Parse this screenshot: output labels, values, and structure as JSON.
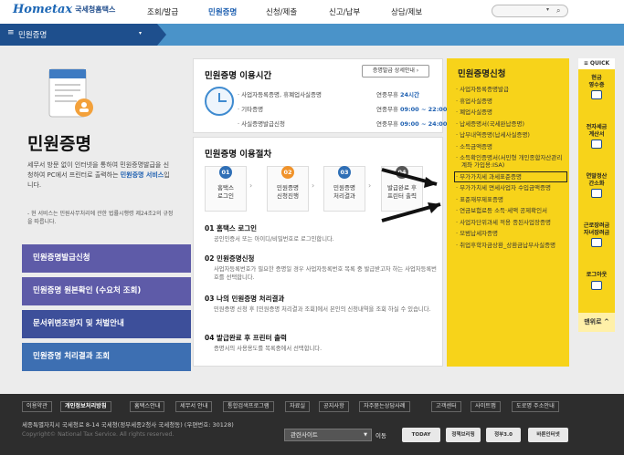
{
  "header": {
    "logo": "Hometax",
    "logo_sub": "국세청홈택스",
    "gnb": [
      "조회/발급",
      "민원증명",
      "신청/제출",
      "신고/납부",
      "상담/제보"
    ],
    "search_icon": "search-icon"
  },
  "nav": {
    "menu_icon": "≡",
    "title": "민원증명",
    "dropdown": "▾"
  },
  "left": {
    "title": "민원증명",
    "desc_a": "세무서 방문 없이 인터넷을 통하여 민원증명발급을 신청하여 PC에서 프린터로 출력하는 ",
    "desc_b": "민원증명 서비스",
    "desc_c": "입니다.",
    "note": "- 현 서비스는 민원사무처리에 관한 법률시행령 제24조2의 규정을 따릅니다.",
    "buttons": [
      "민원증명발급신청",
      "민원증명 원본확인 (수요처 조회)",
      "문서위변조방지 및 처벌안내",
      "민원증명 처리결과 조회"
    ],
    "button_colors": [
      "#5e5ba8",
      "#5e5ba8",
      "#3d4f9a",
      "#3d6fb2"
    ]
  },
  "hours": {
    "title": "민원증명 이용시간",
    "detail_button": "증명발급 상세안내 ›",
    "rows": [
      {
        "name": "· 사업자등록증명, 휴폐업사실증명",
        "val": "연중무휴 ",
        "val_b": "24시간"
      },
      {
        "name": "· 기타증명",
        "val": "연중무휴 ",
        "val_b": "09:00 ~ 22:00"
      },
      {
        "name": "· 사실증명발급신청",
        "val": "연중무휴 ",
        "val_b": "09:00 ~ 24:00"
      }
    ]
  },
  "procedure": {
    "title": "민원증명 이용절차",
    "steps": [
      {
        "num": "01",
        "label": "홈택스\n로그인",
        "color": "#2f6fb6"
      },
      {
        "num": "02",
        "label": "민원증명\n신청진행",
        "color": "#f0932b"
      },
      {
        "num": "03",
        "label": "민원증명\n처리결과",
        "color": "#2f6fb6"
      },
      {
        "num": "04",
        "label": "발급완료 후\n프린터 출력",
        "color": "#555"
      }
    ],
    "items": [
      {
        "h": "01 홈택스 로그인",
        "t": "공인인증서 또는 아이디/비밀번호로 로그인합니다."
      },
      {
        "h": "02 민원증명신청",
        "t": "사업자등록번호가 필요한 증명일 경우 사업자등록번호 목록 중 발급받고자 하는 사업자등록번호를 선택합니다."
      },
      {
        "h": "03 나의 민원증명 처리결과",
        "t": "민원증명 신청 후 [민원증명 처리결과 조회]에서 본인의 신청내역을 조회 하실 수 있습니다."
      },
      {
        "h": "04 발급완료 후 프린터 출력",
        "t": "증명서의 사용용도를 목록중에서 선택합니다."
      }
    ]
  },
  "apply": {
    "title": "민원증명신청",
    "items": [
      "· 사업자등록증명발급",
      "· 휴업사실증명",
      "· 폐업사실증명",
      "· 납세증명서(국세완납증명)",
      "· 납부내역증명(납세사실증명)",
      "· 소득금액증명",
      "· 소득확인증명서(서민형 개인종합자산관리계좌 가입용:ISA)",
      "· 부가가치세 과세표준증명",
      "· 부가가치세 면세사업자 수입금액증명",
      "· 표준재무제표증명",
      "· 연금보험료등 소득·세액 공제확인서",
      "· 사업자단위과세 적용 종된사업장증명",
      "· 모범납세자증명",
      "· 취업후학자금상환_상환금납부사실증명"
    ],
    "highlighted_index": 7
  },
  "quick": {
    "head": "≡ QUICK",
    "items": [
      "현금\n영수증",
      "전자세금\n계산서",
      "연말정산\n간소화",
      "근로장려금\n자녀장려금",
      "로그아웃"
    ],
    "top": "맨위로 ^"
  },
  "footer": {
    "links": [
      "이용약관",
      "개인정보처리방침",
      "홈택스안내",
      "세무서 안내",
      "통합검색프로그램",
      "자료실",
      "공지사항",
      "자주묻는상담사례",
      "고객센터",
      "사이트맵",
      "도로명 주소안내"
    ],
    "bold_index": 1,
    "address": "세종특별자치시 국세청로 8-14 국세청(정부세종2청사 국세청동) (우편번호: 30128)",
    "copyright": "Copyright© National Tax Service. All rights reserved.",
    "related": "관련사이트",
    "go": "이동",
    "badges": [
      "Family",
      "TODAY",
      "정책브리핑",
      "정부3.0",
      "바른인터넷"
    ]
  }
}
